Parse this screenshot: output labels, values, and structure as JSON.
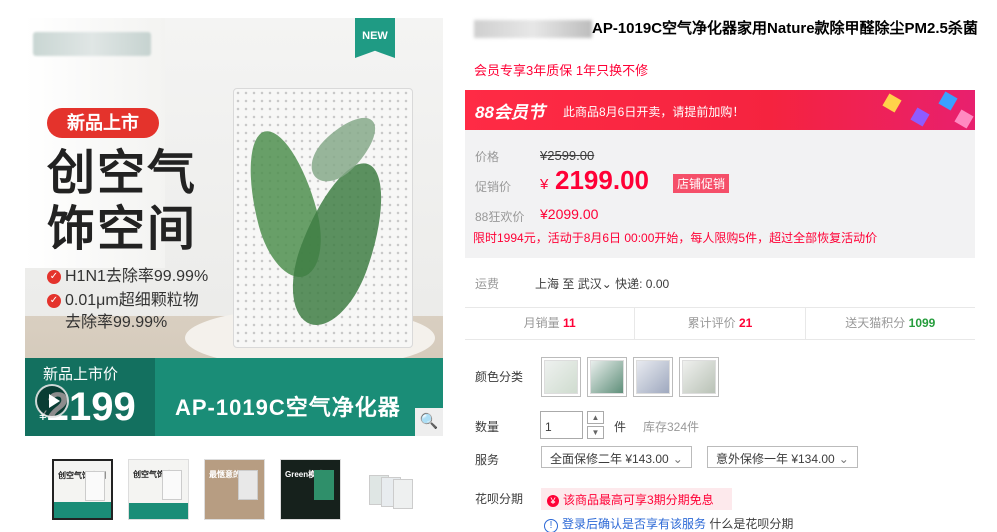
{
  "main_image": {
    "new_badge": "NEW",
    "tag": "新品上市",
    "headline_line1": "创空气",
    "headline_line2": "饰空间",
    "feature1": "H1N1去除率99.99%",
    "feature2": "0.01μm超细颗粒物",
    "feature2b": "去除率99.99%",
    "price_label": "新品上市价",
    "price_symbol": "¥",
    "price_value": "2199",
    "model_text": "AP-1019C空气净化器",
    "play_icon": "play-icon",
    "zoom_icon": "magnifier-icon"
  },
  "thumbnails": [
    {
      "text": "创空气饰空间"
    },
    {
      "text": "创空气饰空间"
    },
    {
      "text": "最惬意的生活"
    },
    {
      "text": "Green模式"
    },
    {
      "text": ""
    }
  ],
  "product": {
    "title": "AP-1019C空气净化器家用Nature款除甲醛除尘PM2.5杀菌",
    "subtitle": "会员专享3年质保 1年只换不修"
  },
  "promo": {
    "logo": "88会员节",
    "notice": "此商品8月6日开卖，请提前加购！"
  },
  "pricing": {
    "list_label": "价格",
    "list_price": "¥2599.00",
    "sale_label": "促销价",
    "sale_symbol": "¥",
    "sale_price": "2199.00",
    "shop_tag": "店铺促销",
    "vip_label": "88狂欢价",
    "vip_price": "¥2099.00",
    "limit_text": "限时1994元，活动于8月6日 00:00开始，每人限购5件，超过全部恢复活动价"
  },
  "shipping": {
    "label": "运费",
    "from": "上海",
    "to_word": "至",
    "to": "武汉",
    "fee": "快递: 0.00"
  },
  "stats": {
    "monthly_label": "月销量",
    "monthly_value": "11",
    "reviews_label": "累计评价",
    "reviews_value": "21",
    "points_label": "送天猫积分",
    "points_value": "1099"
  },
  "options": {
    "color_label": "颜色分类",
    "swatch_count_note": "",
    "qty_label": "数量",
    "qty_value": "1",
    "unit": "件",
    "stock": "库存324件",
    "service_label": "服务",
    "service1": "全面保修二年 ¥143.00",
    "service2": "意外保修一年 ¥134.00",
    "huabei_label": "花呗分期",
    "huabei_text": "该商品最高可享3期分期免息",
    "login_text": "登录后确认是否享有该服务",
    "huabei_link": "什么是花呗分期"
  },
  "colors": {
    "accent": "#ff0036",
    "brand_green": "#1a8d77"
  }
}
